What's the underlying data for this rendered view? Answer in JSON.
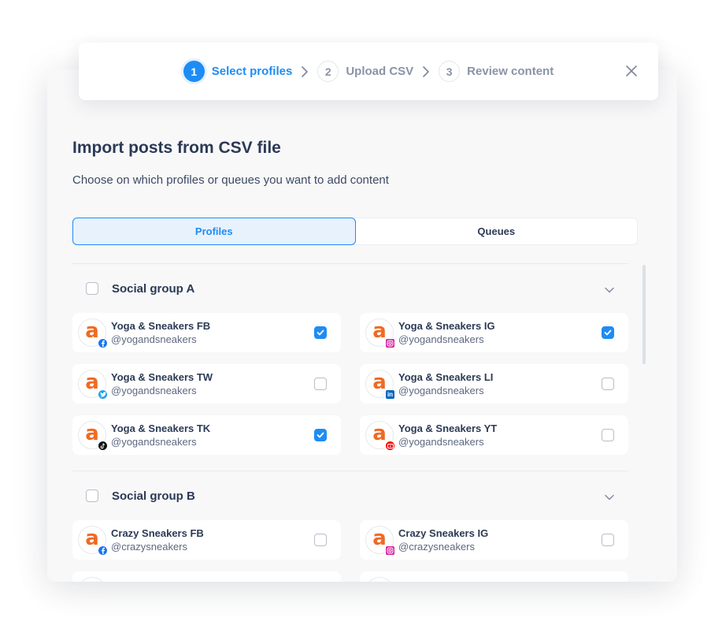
{
  "stepper": {
    "steps": [
      {
        "num": "1",
        "label": "Select profiles",
        "active": true
      },
      {
        "num": "2",
        "label": "Upload CSV",
        "active": false
      },
      {
        "num": "3",
        "label": "Review content",
        "active": false
      }
    ],
    "close_icon": "close-icon"
  },
  "header": {
    "title": "Import posts from CSV file",
    "subtitle": "Choose on which profiles or queues you want to add content"
  },
  "tabs": [
    {
      "label": "Profiles",
      "active": true
    },
    {
      "label": "Queues",
      "active": false
    }
  ],
  "groups": [
    {
      "name": "Social group A",
      "checked": false,
      "profiles": [
        {
          "name": "Yoga & Sneakers FB",
          "handle": "@yogandsneakers",
          "network": "facebook",
          "checked": true
        },
        {
          "name": "Yoga & Sneakers IG",
          "handle": "@yogandsneakers",
          "network": "instagram",
          "checked": true
        },
        {
          "name": "Yoga & Sneakers TW",
          "handle": "@yogandsneakers",
          "network": "twitter",
          "checked": false
        },
        {
          "name": "Yoga & Sneakers LI",
          "handle": "@yogandsneakers",
          "network": "linkedin",
          "checked": false
        },
        {
          "name": "Yoga & Sneakers TK",
          "handle": "@yogandsneakers",
          "network": "tiktok",
          "checked": true
        },
        {
          "name": "Yoga & Sneakers YT",
          "handle": "@yogandsneakers",
          "network": "youtube",
          "checked": false
        }
      ]
    },
    {
      "name": "Social group B",
      "checked": false,
      "profiles": [
        {
          "name": "Crazy Sneakers FB",
          "handle": "@crazysneakers",
          "network": "facebook",
          "checked": false
        },
        {
          "name": "Crazy Sneakers IG",
          "handle": "@crazysneakers",
          "network": "instagram",
          "checked": false
        },
        {
          "name": "",
          "handle": "",
          "network": "",
          "checked": false
        },
        {
          "name": "",
          "handle": "",
          "network": "",
          "checked": false
        }
      ]
    }
  ],
  "avatar_letter": "a",
  "colors": {
    "accent": "#1e8cf5",
    "avatar": "#f06a22",
    "facebook": "#1877f2",
    "instagram": "#d6249f",
    "twitter": "#1da1f2",
    "linkedin": "#0a66c2",
    "tiktok": "#111111",
    "youtube": "#ff0000"
  }
}
